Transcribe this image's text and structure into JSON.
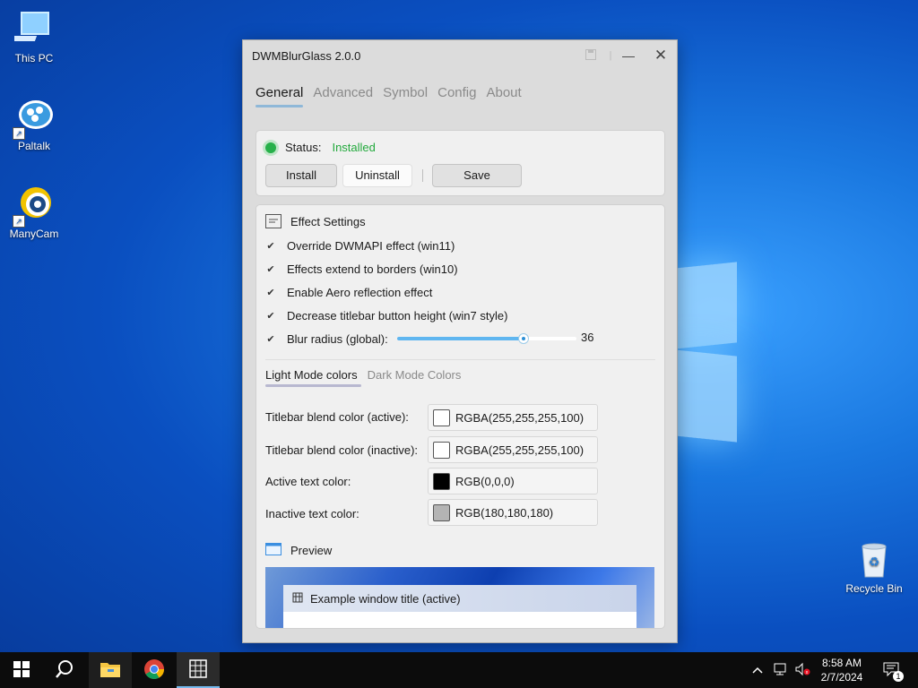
{
  "desktop": {
    "icons": [
      {
        "label": "This PC",
        "icon": "this-pc-icon"
      },
      {
        "label": "Paltalk",
        "icon": "paltalk-icon"
      },
      {
        "label": "ManyCam",
        "icon": "manycam-icon"
      },
      {
        "label": "Recycle Bin",
        "icon": "recycle-bin-icon"
      }
    ]
  },
  "window": {
    "title": "DWMBlurGlass 2.0.0",
    "tabs": [
      "General",
      "Advanced",
      "Symbol",
      "Config",
      "About"
    ],
    "status": {
      "label": "Status:",
      "value": "Installed",
      "color": "#22a93c"
    },
    "buttons": {
      "install": "Install",
      "uninstall": "Uninstall",
      "save": "Save"
    },
    "effect": {
      "header": "Effect Settings",
      "options": [
        "Override DWMAPI effect (win11)",
        "Effects extend to borders (win10)",
        "Enable Aero reflection effect",
        "Decrease titlebar button height (win7 style)"
      ],
      "blur_label": "Blur radius (global):",
      "blur_value": "36",
      "blur_fraction": 0.7
    },
    "color_tabs": [
      "Light Mode colors",
      "Dark Mode Colors"
    ],
    "colors": [
      {
        "label": "Titlebar blend color (active):",
        "value": "RGBA(255,255,255,100)",
        "swatch": "#ffffff"
      },
      {
        "label": "Titlebar blend color (inactive):",
        "value": "RGBA(255,255,255,100)",
        "swatch": "#ffffff"
      },
      {
        "label": "Active text color:",
        "value": "RGB(0,0,0)",
        "swatch": "#000000"
      },
      {
        "label": "Inactive text color:",
        "value": "RGB(180,180,180)",
        "swatch": "#b4b4b4"
      }
    ],
    "preview": {
      "header": "Preview",
      "window_title": "Example window title (active)"
    }
  },
  "taskbar": {
    "items": [
      "start-icon",
      "search-icon",
      "file-explorer-icon",
      "chrome-icon",
      "dwmblurglass-icon"
    ],
    "time": "8:58 AM",
    "date": "2/7/2024",
    "notification_count": "1"
  }
}
